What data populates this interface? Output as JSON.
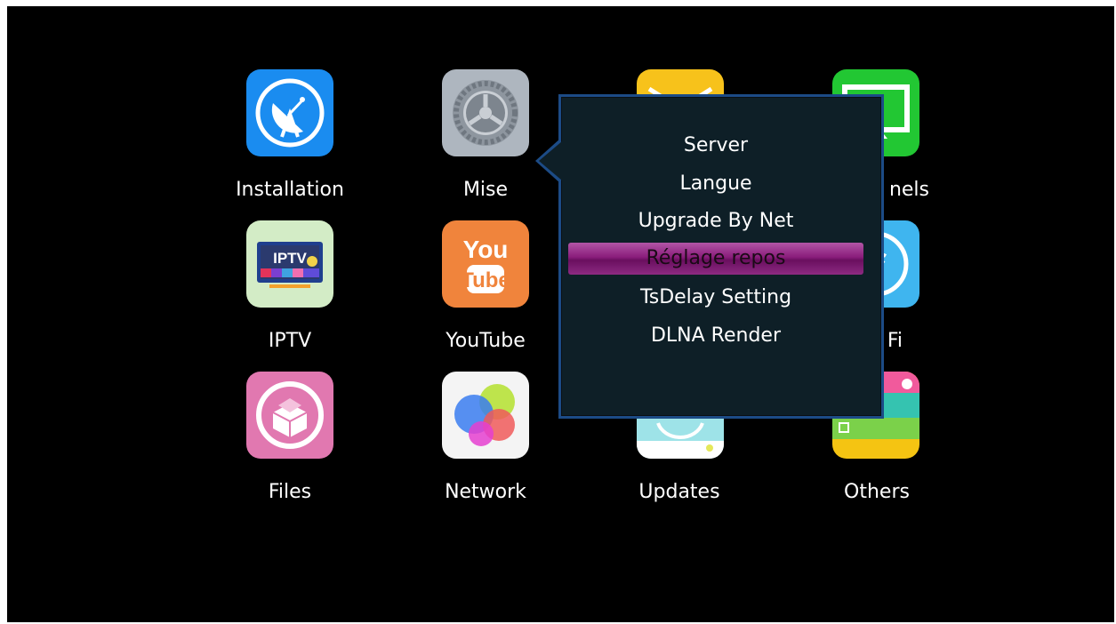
{
  "apps": [
    {
      "label": "Installation",
      "icon": "satellite-dish-icon",
      "color": "#1a8cf0"
    },
    {
      "label": "Mise",
      "icon": "settings-gear-icon",
      "color": "#aeb6bf"
    },
    {
      "label": "",
      "icon": "mail-icon",
      "color": "#f7c21b"
    },
    {
      "label": "nels",
      "icon": "tv-screen-icon",
      "color": "#22c733"
    },
    {
      "label": "IPTV",
      "icon": "iptv-icon",
      "color": "#d3ecc6"
    },
    {
      "label": "YouTube",
      "icon": "youtube-icon",
      "color": "#f0843c"
    },
    {
      "label": "",
      "icon": "hidden-app-icon",
      "color": "#000000"
    },
    {
      "label": "Fi",
      "icon": "wifi-icon",
      "color": "#3fb5ef"
    },
    {
      "label": "Files",
      "icon": "package-icon",
      "color": "#e178b0"
    },
    {
      "label": "Network",
      "icon": "game-center-icon",
      "color": "#ffffff"
    },
    {
      "label": "Updates",
      "icon": "updates-icon",
      "color": "#9ee3e8"
    },
    {
      "label": "Others",
      "icon": "others-icon",
      "color": "#f5c412"
    }
  ],
  "submenu": {
    "items": [
      {
        "label": "Server",
        "selected": false
      },
      {
        "label": "Langue",
        "selected": false
      },
      {
        "label": "Upgrade By Net",
        "selected": false
      },
      {
        "label": "Réglage repos",
        "selected": true
      },
      {
        "label": "TsDelay Setting",
        "selected": false
      },
      {
        "label": "DLNA Render",
        "selected": false
      }
    ],
    "highlight_color": "#8a1d7b",
    "border_color": "#1c4b86"
  }
}
